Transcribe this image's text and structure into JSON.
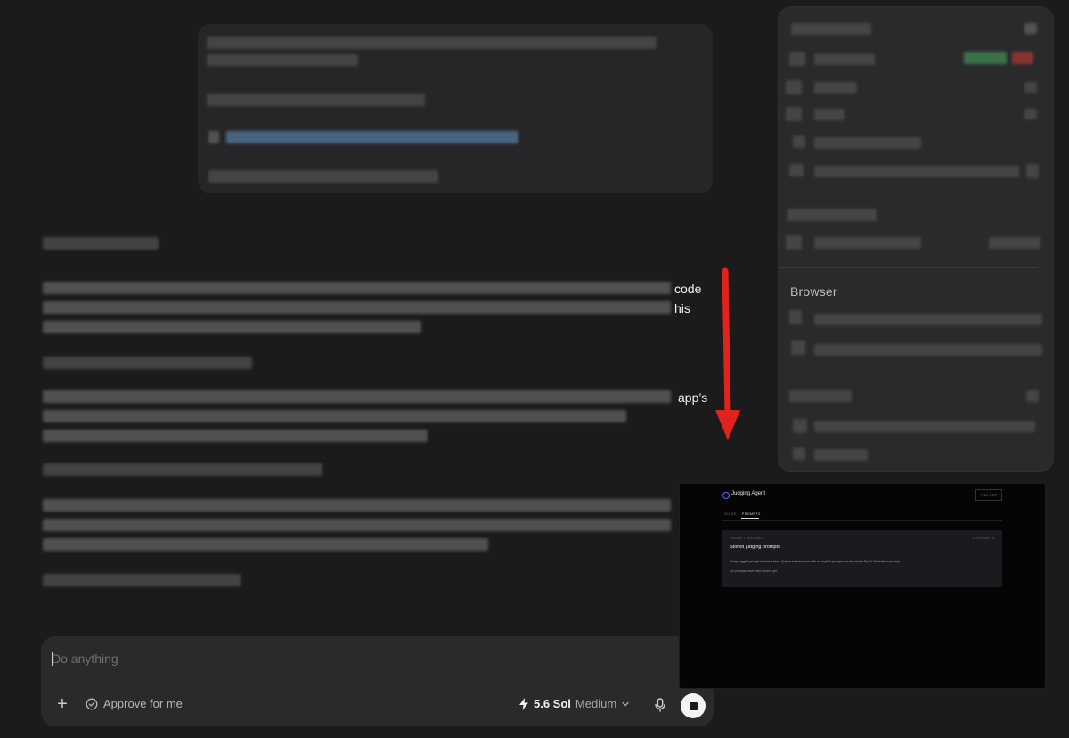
{
  "transcript": {
    "fragment_1": "code",
    "fragment_2": "his",
    "fragment_3": "app’s"
  },
  "side_panel": {
    "browser_heading": "Browser"
  },
  "composer": {
    "placeholder": "Do anything",
    "approve_label": "Approve for me",
    "model_name": "5.6 Sol",
    "model_effort": "Medium"
  },
  "overlay": {
    "app_title": "Judging Agent",
    "logout_label": "LOG OUT",
    "tabs": [
      "GUIDE",
      "PROMPTS"
    ],
    "card": {
      "eyebrow": "PROMPT HISTORY",
      "count": "0 PROMPTS",
      "title": "Stored judging prompts",
      "description": "Every logged prompt is stored here. Queue submissions with no explicit prompt use the stored Spark Hackathon prompt.",
      "empty_state": "No prompts have been stored yet."
    }
  },
  "colors": {
    "background": "#1b1b1c",
    "panel": "#2a2a2c",
    "arrow": "#e0231c",
    "overlay_accent": "#5d6cff"
  }
}
